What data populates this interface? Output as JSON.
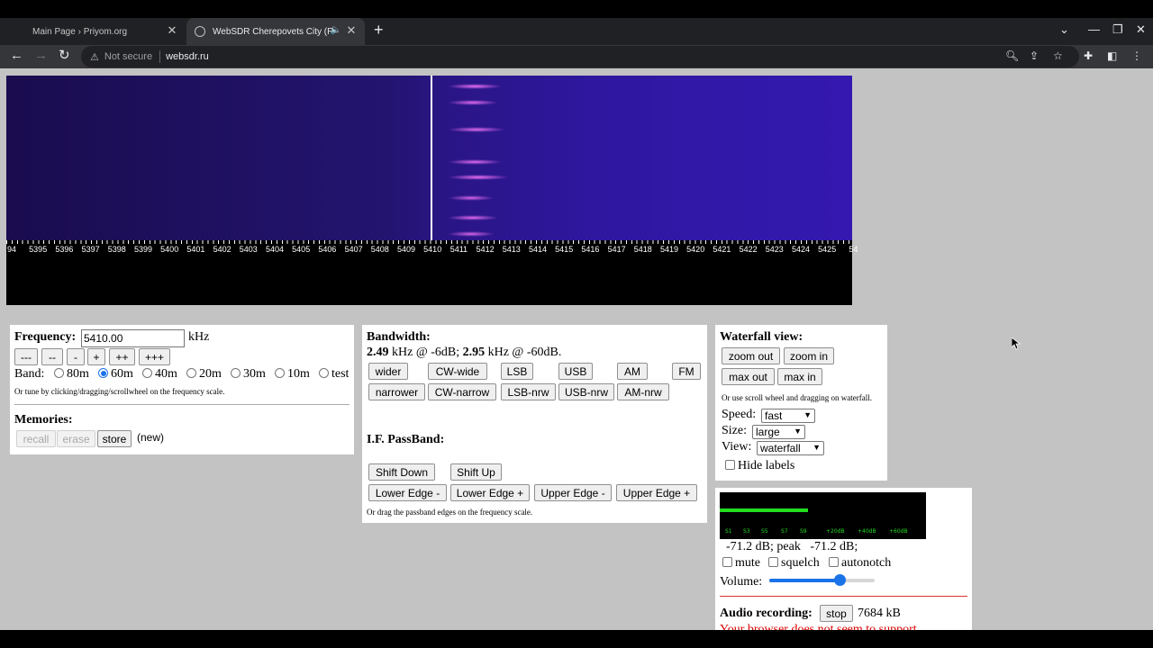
{
  "browser": {
    "tabs": [
      {
        "title": "Main Page › Priyom.org",
        "active": false
      },
      {
        "title": "WebSDR Cherepovets City (R",
        "active": true
      }
    ],
    "new_tab_label": "+",
    "security_label": "Not secure",
    "url": "websdr.ru",
    "icons": [
      "back-arrow-icon",
      "forward-arrow-icon",
      "reload-icon",
      "warning-icon",
      "zoom-icon",
      "share-icon",
      "star-icon",
      "extensions-icon",
      "side-panel-icon",
      "menu-icon"
    ]
  },
  "waterfall": {
    "scale_labels": [
      "94",
      "5395",
      "5396",
      "5397",
      "5398",
      "5399",
      "5400",
      "5401",
      "5402",
      "5403",
      "5404",
      "5405",
      "5406",
      "5407",
      "5408",
      "5409",
      "5410",
      "5411",
      "5412",
      "5413",
      "5414",
      "5415",
      "5416",
      "5417",
      "5418",
      "5419",
      "5420",
      "5421",
      "5422",
      "5423",
      "5424",
      "5425",
      "54"
    ],
    "colors": {
      "background": "#1a0c4e",
      "signal": "#ff78ff",
      "cursor": "#ffffff"
    }
  },
  "frequency": {
    "label": "Frequency:",
    "value": "5410.00",
    "unit": "kHz",
    "step_buttons": [
      "---",
      "--",
      "-",
      "+",
      "++",
      "+++"
    ],
    "band_label": "Band:",
    "bands": [
      {
        "label": "80m",
        "checked": false
      },
      {
        "label": "60m",
        "checked": true
      },
      {
        "label": "40m",
        "checked": false
      },
      {
        "label": "20m",
        "checked": false
      },
      {
        "label": "30m",
        "checked": false
      },
      {
        "label": "10m",
        "checked": false
      },
      {
        "label": "test",
        "checked": false
      }
    ],
    "hint": "Or tune by clicking/dragging/scrollwheel on the frequency scale.",
    "memories_label": "Memories:",
    "memory_buttons": {
      "recall": "recall",
      "erase": "erase",
      "store": "store"
    },
    "memory_new": "(new)"
  },
  "bandwidth": {
    "label": "Bandwidth:",
    "value_6db": "2.49",
    "text_6db": " kHz @ -6dB; ",
    "value_60db": "2.95",
    "text_60db": " kHz @ -60dB.",
    "row1": [
      "wider",
      "CW-wide",
      "LSB",
      "USB",
      "AM",
      "FM"
    ],
    "row2": [
      "narrower",
      "CW-narrow",
      "LSB-nrw",
      "USB-nrw",
      "AM-nrw"
    ],
    "passband_label": "I.F. PassBand:",
    "shift_buttons": [
      "Shift Down",
      "Shift Up"
    ],
    "edge_buttons": [
      "Lower Edge -",
      "Lower Edge +",
      "Upper Edge -",
      "Upper Edge +"
    ],
    "hint": "Or drag the passband edges on the frequency scale."
  },
  "waterfall_view": {
    "label": "Waterfall view:",
    "buttons": [
      "zoom out",
      "zoom in",
      "max out",
      "max in"
    ],
    "hint": "Or use scroll wheel and dragging on waterfall.",
    "speed_label": "Speed:",
    "speed_value": "fast",
    "size_label": "Size:",
    "size_value": "large",
    "view_label": "View:",
    "view_value": "waterfall",
    "hide_labels": "Hide labels"
  },
  "audio": {
    "smeter_labels": [
      "S1",
      "S3",
      "S5",
      "S7",
      "S9",
      "+20dB",
      "+40dB",
      "+60dB"
    ],
    "smeter_level": 0.43,
    "readout": "-71.2 dB; peak   -71.2 dB;",
    "checks": [
      "mute",
      "squelch",
      "autonotch"
    ],
    "volume_label": "Volume:",
    "volume_fraction": 0.67,
    "recording_label": "Audio recording:",
    "recording_button": "stop",
    "recording_size": "7684 kB",
    "warning_text": "Your browser does not seem to support"
  }
}
